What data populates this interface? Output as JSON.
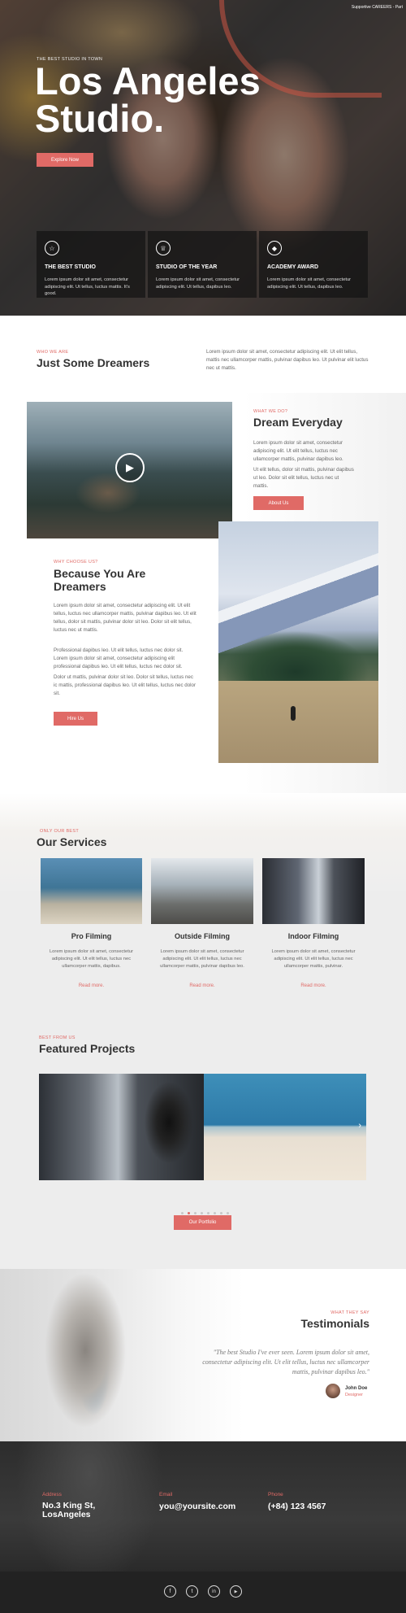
{
  "topbar": {
    "text": "Supportive CAREERS - Part"
  },
  "hero": {
    "kicker": "THE BEST STUDIO IN TOWN",
    "title_line1": "Los Angeles",
    "title_line2": "Studio.",
    "button": "Explore Now",
    "features": [
      {
        "icon": "star-icon",
        "glyph": "☆",
        "title": "THE BEST STUDIO",
        "text": "Lorem ipsum dolor sit amet, consectetur adipiscing elit. Ut tellus, luctus mattis. It's good."
      },
      {
        "icon": "trophy-icon",
        "glyph": "♕",
        "title": "STUDIO OF THE YEAR",
        "text": "Lorem ipsum dolor sit amet, consectetur adipiscing elit. Ut tellus, dapibus leo."
      },
      {
        "icon": "graduation-cap-icon",
        "glyph": "◆",
        "title": "ACADEMY AWARD",
        "text": "Lorem ipsum dolor sit amet, consectetur adipiscing elit. Ut tellus, dapibus leo."
      }
    ]
  },
  "intro": {
    "kicker": "WHO WE ARE",
    "title": "Just Some Dreamers",
    "text": "Lorem ipsum dolor sit amet, consectetur adipiscing elit. Ut elit tellus, mattis nec ullamcorper mattis, pulvinar dapibus leo. Ut pulvinar elit luctus nec ut mattis."
  },
  "dream": {
    "kicker": "WHAT WE DO?",
    "title": "Dream Everyday",
    "p1": "Lorem ipsum dolor sit amet, consectetur adipiscing elit. Ut elit tellus, luctus nec ullamcorper mattis, pulvinar dapibus leo.",
    "p2": "Ut elit tellus, dolor sit mattis, pulvinar dapibus ut leo. Dolor sit elit tellus, luctus nec ut mattis.",
    "button": "About Us"
  },
  "because": {
    "kicker": "WHY CHOOSE US?",
    "title_line1": "Because You Are",
    "title_line2": "Dreamers",
    "p1": "Lorem ipsum dolor sit amet, consectetur adipiscing elit. Ut elit tellus, luctus nec ullamcorper mattis, pulvinar dapibus leo. Ut elit tellus, dolor sit mattis, pulvinar dolor sit leo. Dolor sit elit tellus, luctus nec ut mattis.",
    "p2": "Professional dapibus leo. Ut elit tellus, luctus nec dolor sit. Lorem ipsum dolor sit amet, consectetur adipiscing elit professional dapibus leo. Ut elit tellus, luctus nec dolor sit.",
    "p3": "Dolor ut mattis, pulvinar dolor sit leo. Dolor sit tellus, luctus nec ic mattis, professional dapibus leo. Ut elit tellus, luctus nec dolor sit.",
    "button": "Hire Us"
  },
  "services": {
    "kicker": "ONLY OUR BEST",
    "title": "Our Services",
    "items": [
      {
        "title": "Pro Filming",
        "text": "Lorem ipsum dolor sit amet, consectetur adipiscing elit. Ut elit tellus, luctus nec ullamcorper mattis, dapibus.",
        "link": "Read more."
      },
      {
        "title": "Outside Filming",
        "text": "Lorem ipsum dolor sit amet, consectetur adipiscing elit. Ut elit tellus, luctus nec ullamcorper mattis, pulvinar dapibus leo.",
        "link": "Read more."
      },
      {
        "title": "Indoor Filming",
        "text": "Lorem ipsum dolor sit amet, consectetur adipiscing elit. Ut elit tellus, luctus nec ullamcorper mattis, pulvinar.",
        "link": "Read more."
      }
    ]
  },
  "projects": {
    "kicker": "BEST FROM US",
    "title": "Featured Projects",
    "button": "Our Portfolio",
    "arrow": "›"
  },
  "testimonials": {
    "kicker": "WHAT THEY SAY",
    "title": "Testimonials",
    "quote": "\"The best Studio I've ever seen. Lorem ipsum dolor sit amet, consectetur adipiscing elit. Ut elit tellus, luctus nec ullamcorper mattis, pulvinar dapibus leo.\"",
    "name": "John Doe",
    "role": "Designer"
  },
  "contact": {
    "address_label": "Address",
    "address_line1": "No.3 King St,",
    "address_line2": "LosAngeles",
    "email_label": "Email",
    "email": "you@yoursite.com",
    "phone_label": "Phone",
    "phone": "(+84) 123 4567"
  },
  "social": [
    {
      "icon": "facebook-icon",
      "glyph": "f"
    },
    {
      "icon": "twitter-icon",
      "glyph": "t"
    },
    {
      "icon": "linkedin-icon",
      "glyph": "in"
    },
    {
      "icon": "youtube-icon",
      "glyph": "▶"
    }
  ],
  "colors": {
    "accent": "#e06a66",
    "dark": "#2d2d2d"
  }
}
